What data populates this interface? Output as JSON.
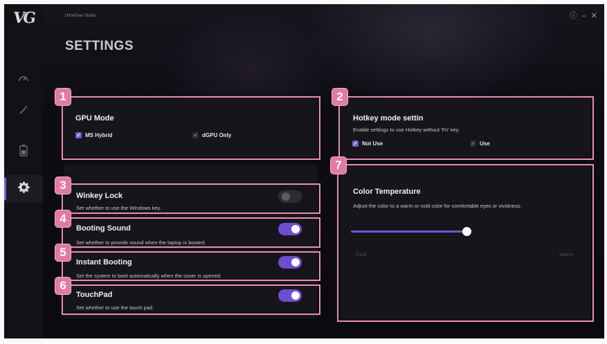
{
  "app": {
    "title": "UltraGear Studio"
  },
  "window_controls": {
    "info": "ⓘ",
    "minimize": "–",
    "close": "✕"
  },
  "page": {
    "title": "SETTINGS"
  },
  "sidebar": {
    "items": [
      {
        "name": "performance",
        "icon": "speedometer-icon"
      },
      {
        "name": "lighting",
        "icon": "magic-wand-icon"
      },
      {
        "name": "battery",
        "icon": "battery-icon"
      },
      {
        "name": "settings",
        "icon": "gear-icon",
        "active": true
      }
    ]
  },
  "gpu_mode": {
    "badge": "1",
    "title": "GPU Mode",
    "options": [
      {
        "label": "MS Hybrid",
        "checked": true
      },
      {
        "label": "dGPU Only",
        "checked": false
      }
    ]
  },
  "hotkey_mode": {
    "badge": "2",
    "title": "Hotkey mode settin",
    "description": "Enable settings to use Hotkey without 'Fn' key.",
    "options": [
      {
        "label": "Not Use",
        "checked": true
      },
      {
        "label": "Use",
        "checked": false
      }
    ]
  },
  "winkey_lock": {
    "badge": "3",
    "title": "Winkey Lock",
    "description": "Set whether to use the Windows key.",
    "enabled": false
  },
  "booting_sound": {
    "badge": "4",
    "title": "Booting Sound",
    "description": "Set whether to provide sound when the laptop is booted.",
    "enabled": true
  },
  "instant_booting": {
    "badge": "5",
    "title": "Instant Booting",
    "description": "Set the system to boot automatically when the cover is opened.",
    "enabled": true
  },
  "touchpad": {
    "badge": "6",
    "title": "TouchPad",
    "description": "Set whether to use the touch pad.",
    "enabled": true
  },
  "color_temperature": {
    "badge": "7",
    "title": "Color Temperature",
    "description": "Adjust the color to a warm or cold color for comfortable eyes or vividness.",
    "min_label": "Cold",
    "max_label": "Warm",
    "value_fraction": 1.0
  },
  "colors": {
    "accent": "#7c58d6",
    "highlight": "#ea8fb3",
    "badge": "#e27aa1",
    "background": "#0c0b10"
  }
}
